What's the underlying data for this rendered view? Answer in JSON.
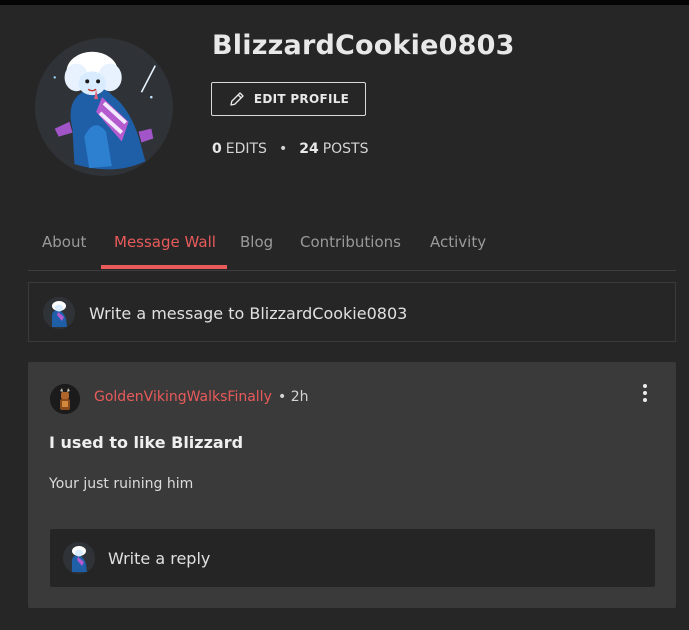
{
  "profile": {
    "username": "BlizzardCookie0803",
    "edit_button_label": "EDIT PROFILE",
    "edits_count": "0",
    "edits_label": "EDITS",
    "posts_count": "24",
    "posts_label": "POSTS",
    "separator": "•"
  },
  "tabs": [
    {
      "label": "About",
      "active": false
    },
    {
      "label": "Message Wall",
      "active": true
    },
    {
      "label": "Blog",
      "active": false
    },
    {
      "label": "Contributions",
      "active": false
    },
    {
      "label": "Activity",
      "active": false
    }
  ],
  "compose": {
    "placeholder": "Write a message to BlizzardCookie0803"
  },
  "post": {
    "author": "GoldenVikingWalksFinally",
    "time": "• 2h",
    "title": "I used to like Blizzard",
    "body": "Your just ruining him",
    "reply_placeholder": "Write a reply"
  },
  "colors": {
    "accent": "#e95a5a",
    "background": "#262626",
    "card": "#3a3a3a",
    "reply_box": "#252525"
  },
  "icons": {
    "edit": "pencil-icon",
    "more": "kebab-menu-icon"
  }
}
